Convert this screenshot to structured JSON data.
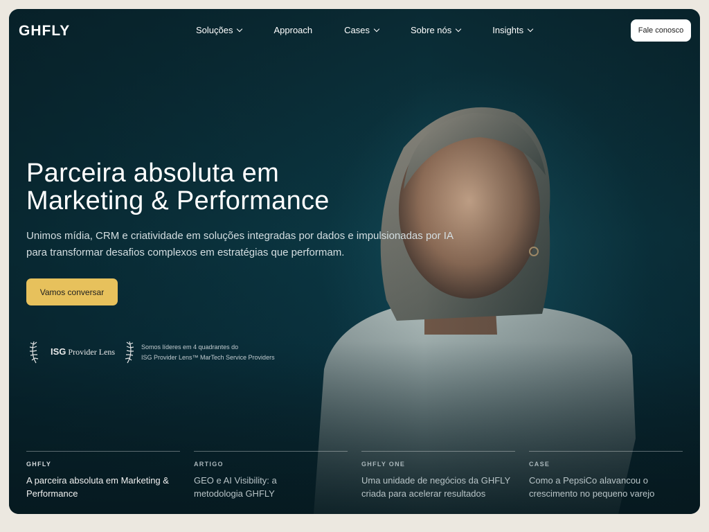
{
  "brand": {
    "logo": "GHFLY"
  },
  "nav": {
    "items": [
      {
        "label": "Soluções",
        "dropdown": true
      },
      {
        "label": "Approach",
        "dropdown": false
      },
      {
        "label": "Cases",
        "dropdown": true
      },
      {
        "label": "Sobre nós",
        "dropdown": true
      },
      {
        "label": "Insights",
        "dropdown": true
      }
    ],
    "cta": "Fale conosco"
  },
  "hero": {
    "headline_line1": "Parceira absoluta em",
    "headline_line2": "Marketing & Performance",
    "subtitle": "Unimos mídia, CRM e criatividade em soluções integradas por dados e impulsionadas por IA para transformar desafios complexos em estratégias que performam.",
    "cta": "Vamos conversar"
  },
  "award": {
    "logo_mark": "ISG",
    "logo_text": "Provider Lens",
    "line1": "Somos líderes em 4 quadrantes do",
    "line2": "ISG Provider Lens™ MarTech Service Providers"
  },
  "cards": [
    {
      "tag": "GHFLY",
      "text": "A parceira absoluta em Marketing & Performance"
    },
    {
      "tag": "ARTIGO",
      "text": "GEO e AI Visibility: a metodologia GHFLY"
    },
    {
      "tag": "GHFLY ONE",
      "text": "Uma unidade de negócios da GHFLY  criada para acelerar resultados"
    },
    {
      "tag": "CASE",
      "text": "Como a PepsiCo alavancou o crescimento no pequeno varejo"
    }
  ],
  "colors": {
    "accent": "#e7c15c",
    "hero_bg": "#0c3a46",
    "page_bg": "#ece8e0"
  }
}
